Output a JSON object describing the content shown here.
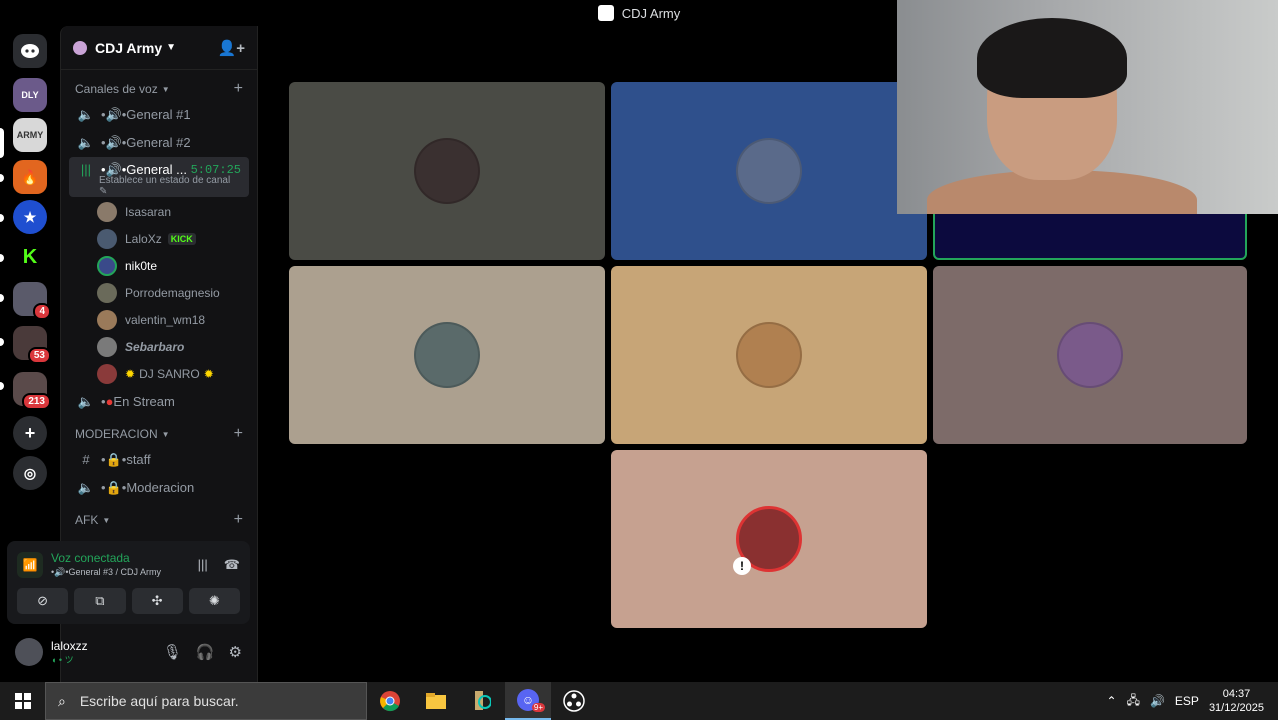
{
  "window": {
    "title": "CDJ Army"
  },
  "rail": {
    "servers": [
      {
        "name": "discord-home",
        "badge": ""
      },
      {
        "name": "server-daily",
        "badge": ""
      },
      {
        "name": "server-cdj-army",
        "badge": ""
      },
      {
        "name": "server-fire",
        "badge": ""
      },
      {
        "name": "server-star",
        "badge": ""
      },
      {
        "name": "server-kick",
        "badge": ""
      },
      {
        "name": "server-4",
        "badge": "4"
      },
      {
        "name": "server-53",
        "badge": "53"
      },
      {
        "name": "server-213",
        "badge": "213"
      }
    ]
  },
  "server": {
    "name": "CDJ Army"
  },
  "categories": {
    "voice": "Canales de voz",
    "moderation": "MODERACION",
    "afk": "AFK"
  },
  "channels": {
    "general1": "General #1",
    "general2": "General #2",
    "general3": "General ...",
    "general3_timer": "5:07:25",
    "general3_status": "Establece un estado de canal",
    "enstream": "En Stream",
    "staff": "staff",
    "moderacion": "Moderacion"
  },
  "voice_users": [
    {
      "name": "Isasaran",
      "color": "#8a7a6a"
    },
    {
      "name": "LaloXz",
      "color": "#4a5a70",
      "tag": "KICK"
    },
    {
      "name": "nik0te",
      "color": "#3a4a8a"
    },
    {
      "name": "Porrodemagnesio",
      "color": "#6a6a5a"
    },
    {
      "name": "valentin_wm18",
      "color": "#9a7a5a"
    },
    {
      "name": "Sebarbaro",
      "color": "#7a7a7a"
    },
    {
      "name": "DJ SANRO",
      "color": "#8a3a3a"
    }
  ],
  "voice_panel": {
    "title": "Voz conectada",
    "subtitle": "General #3 / CDJ Army"
  },
  "user_panel": {
    "username": "laloxzz",
    "status": "ツ"
  },
  "tiles": [
    {
      "bg": "#4a4b45",
      "avatar": "#3a3030"
    },
    {
      "bg": "#2f508c",
      "avatar": "#5a6a8a"
    },
    {
      "bg": "#0c0a3e",
      "avatar": ""
    },
    {
      "bg": "#aca08f",
      "avatar": "#5a6a6a"
    },
    {
      "bg": "#c7a577",
      "avatar": "#b08050"
    },
    {
      "bg": "#7d6b69",
      "avatar": "#7a5a8a"
    },
    {
      "bg": "#c6a190",
      "avatar": "#8a3030"
    }
  ],
  "taskbar": {
    "search_placeholder": "Escribe aquí para buscar.",
    "lang": "ESP",
    "time": "04:37",
    "date": "31/12/2025",
    "discord_badge": "9+"
  }
}
